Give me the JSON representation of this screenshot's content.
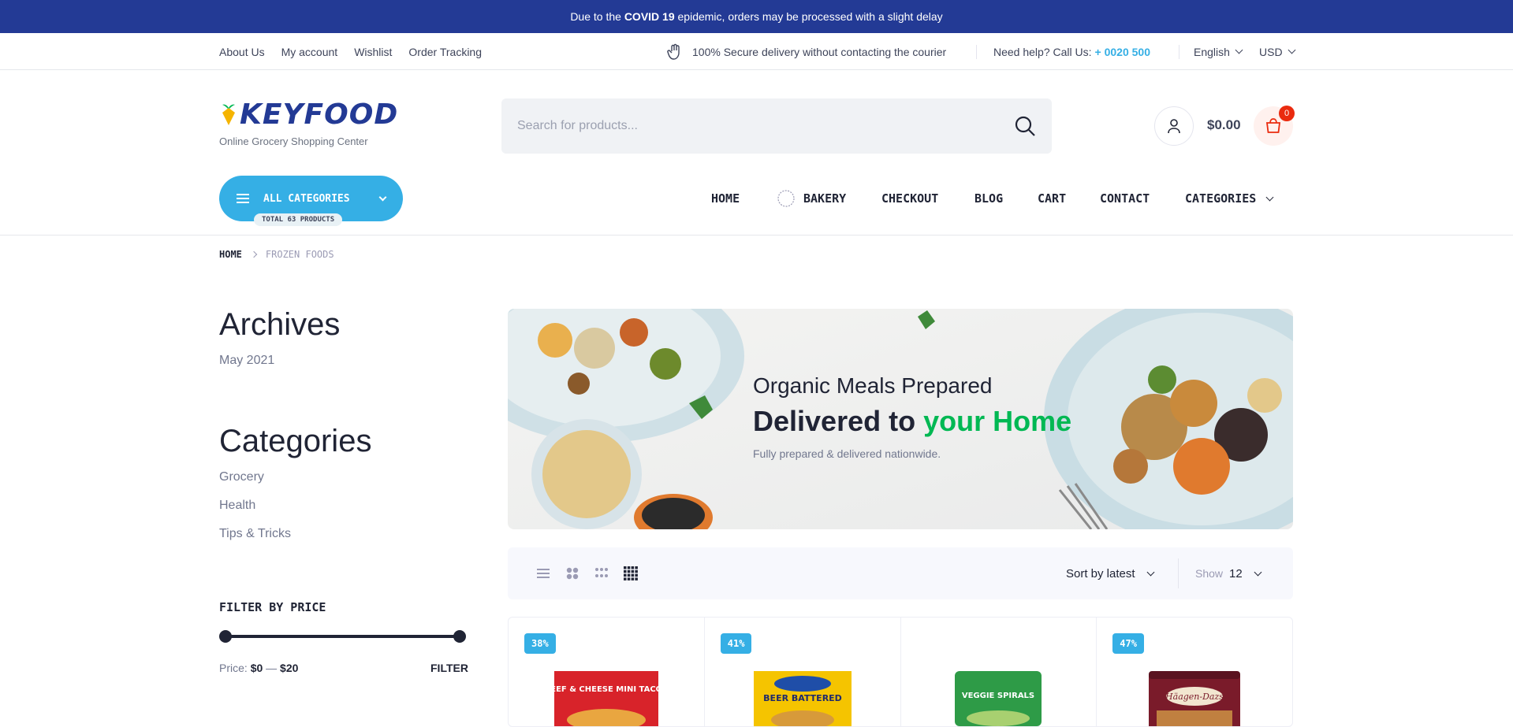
{
  "topbar": {
    "prefix": "Due to the",
    "highlight": "COVID 19",
    "suffix": "epidemic, orders may be processed with a slight delay"
  },
  "utility": {
    "links": [
      "About Us",
      "My account",
      "Wishlist",
      "Order Tracking"
    ],
    "secure_text": "100% Secure delivery without contacting the courier",
    "help_text": "Need help? Call Us:",
    "phone": "+ 0020 500",
    "language": "English",
    "currency": "USD"
  },
  "header": {
    "logo_text": "KEYFOOD",
    "tagline": "Online Grocery Shopping Center",
    "search_placeholder": "Search for products...",
    "cart_total": "$0.00",
    "cart_count": "0"
  },
  "nav": {
    "all_categories": "ALL CATEGORIES",
    "total_products": "TOTAL 63 PRODUCTS",
    "items": [
      "HOME",
      "BAKERY",
      "CHECKOUT",
      "BLOG",
      "CART",
      "CONTACT",
      "CATEGORIES"
    ]
  },
  "breadcrumb": {
    "home": "HOME",
    "current": "FROZEN FOODS"
  },
  "sidebar": {
    "archives_title": "Archives",
    "archives": [
      "May 2021"
    ],
    "categories_title": "Categories",
    "categories": [
      "Grocery",
      "Health",
      "Tips & Tricks"
    ],
    "filter_title": "FILTER BY PRICE",
    "price_label": "Price:",
    "price_min": "$0",
    "price_sep": "—",
    "price_max": "$20",
    "filter_button": "FILTER"
  },
  "banner": {
    "line1": "Organic Meals Prepared",
    "line2_a": "Delivered to",
    "line2_b": "your Home",
    "line3": "Fully prepared & delivered nationwide."
  },
  "toolbar": {
    "sort_label": "Sort by latest",
    "show_label": "Show",
    "show_value": "12"
  },
  "products": [
    {
      "discount": "38%",
      "image_text": "BEEF & CHEESE MINI TACOS"
    },
    {
      "discount": "41%",
      "image_text": "BEER BATTERED"
    },
    {
      "discount": "",
      "image_text": "VEGGIE SPIRALS"
    },
    {
      "discount": "47%",
      "image_text": "Häagen-Dazs"
    }
  ],
  "colors": {
    "brand_blue": "#233a95",
    "accent_cyan": "#35afe5",
    "green": "#00b853",
    "cart_badge": "#ea2b0f"
  }
}
